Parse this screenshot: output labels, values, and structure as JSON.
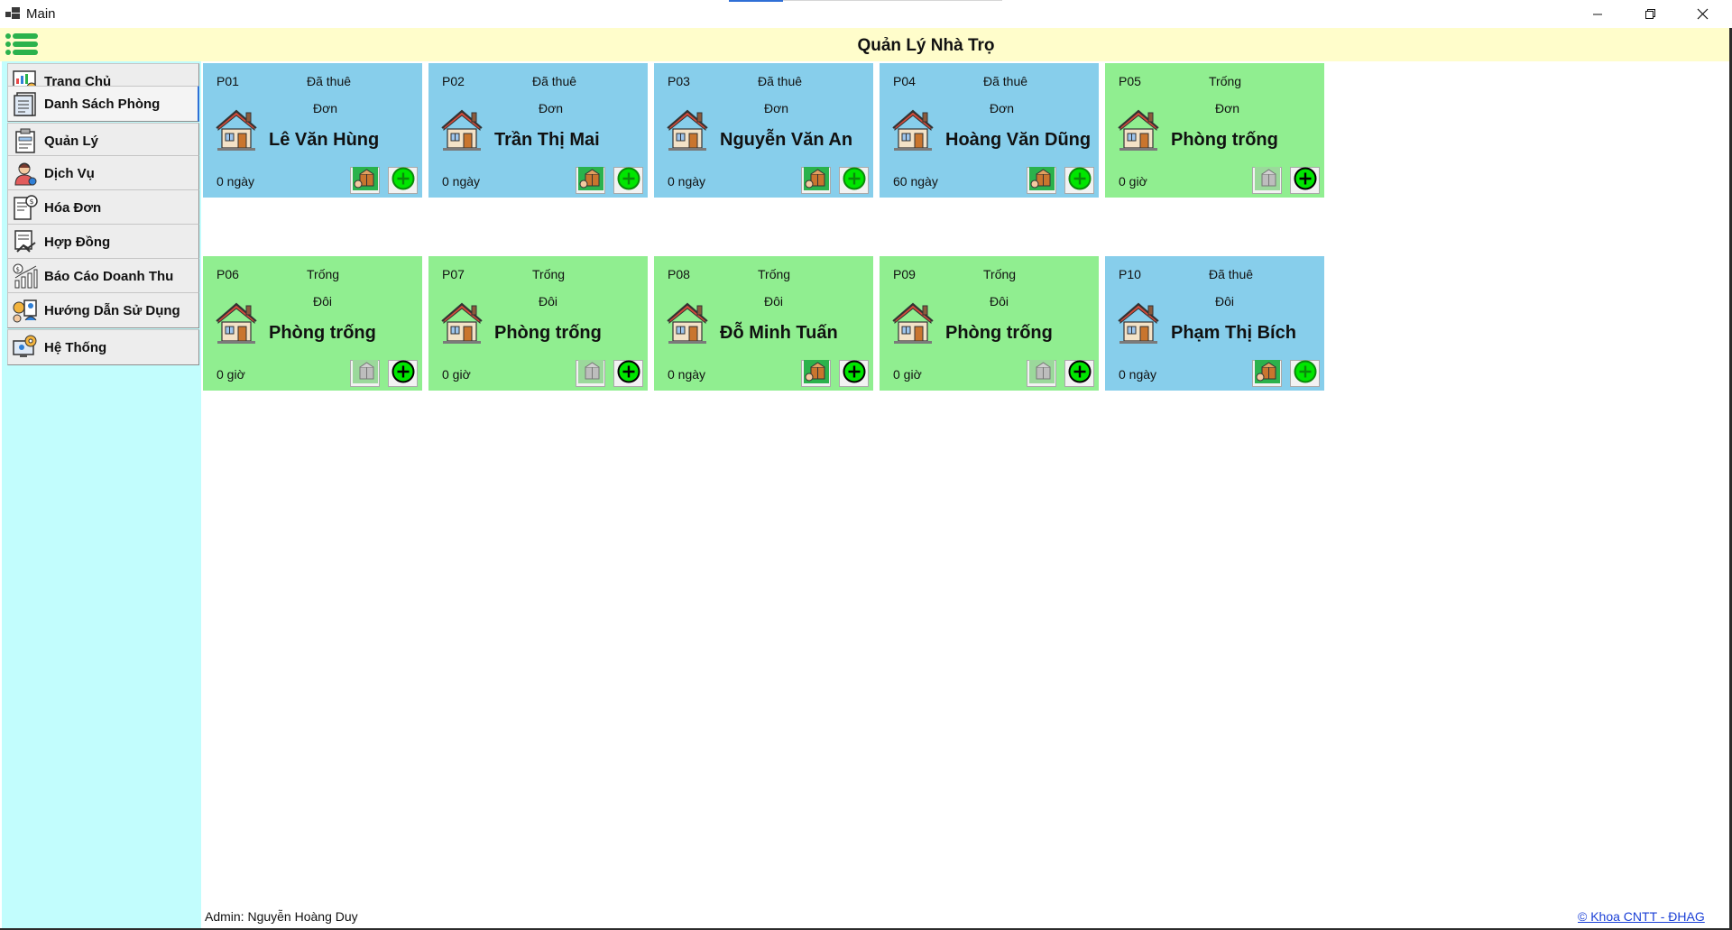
{
  "window": {
    "title": "Main",
    "controls": {
      "minimize": "minimize-icon",
      "restore": "restore-icon",
      "close": "close-icon"
    }
  },
  "header": {
    "title": "Quản Lý Nhà Trọ",
    "menu_icon": "hamburger-menu-icon",
    "background": "#fffdcb"
  },
  "sidebar": {
    "background": "#c2fdfd",
    "items": [
      {
        "label": "Trang Chủ",
        "icon": "dashboard-icon"
      },
      {
        "label": "Danh Sách Phòng",
        "icon": "room-list-icon",
        "active": true
      },
      {
        "label": "Quản Lý",
        "icon": "clipboard-icon"
      },
      {
        "label": "Dịch Vụ",
        "icon": "service-staff-icon"
      },
      {
        "label": "Hóa Đơn",
        "icon": "invoice-icon"
      },
      {
        "label": "Hợp Đồng",
        "icon": "contract-handshake-icon"
      },
      {
        "label": "Báo Cáo Doanh Thu",
        "icon": "revenue-chart-icon"
      },
      {
        "label": "Hướng Dẫn Sử Dụng",
        "icon": "user-guide-icon"
      },
      {
        "label": "Hệ Thống",
        "icon": "system-settings-icon"
      }
    ]
  },
  "colors": {
    "occupied": "#87ceeb",
    "vacant": "#90ee90",
    "add_button": "#00e600",
    "accent": "#2f6fd6"
  },
  "rooms": [
    {
      "code": "P01",
      "status": "Đã thuê",
      "type": "Đơn",
      "tenant": "Lê Văn Hùng",
      "duration": "0 ngày",
      "occupied": true
    },
    {
      "code": "P02",
      "status": "Đã thuê",
      "type": "Đơn",
      "tenant": "Trần Thị Mai",
      "duration": "0 ngày",
      "occupied": true
    },
    {
      "code": "P03",
      "status": "Đã thuê",
      "type": "Đơn",
      "tenant": "Nguyễn Văn An",
      "duration": "0 ngày",
      "occupied": true
    },
    {
      "code": "P04",
      "status": "Đã thuê",
      "type": "Đơn",
      "tenant": "Hoàng Văn Dũng",
      "duration": "60 ngày",
      "occupied": true
    },
    {
      "code": "P05",
      "status": "Trống",
      "type": "Đơn",
      "tenant": "Phòng trống",
      "duration": "0 giờ",
      "occupied": false
    },
    {
      "code": "P06",
      "status": "Trống",
      "type": "Đôi",
      "tenant": "Phòng trống",
      "duration": "0 giờ",
      "occupied": false
    },
    {
      "code": "P07",
      "status": "Trống",
      "type": "Đôi",
      "tenant": "Phòng trống",
      "duration": "0 giờ",
      "occupied": false
    },
    {
      "code": "P08",
      "status": "Trống",
      "type": "Đôi",
      "tenant": "Đỗ Minh Tuấn",
      "duration": "0 ngày",
      "occupied": false
    },
    {
      "code": "P09",
      "status": "Trống",
      "type": "Đôi",
      "tenant": "Phòng trống",
      "duration": "0 giờ",
      "occupied": false
    },
    {
      "code": "P10",
      "status": "Đã thuê",
      "type": "Đôi",
      "tenant": "Phạm Thị Bích",
      "duration": "0 ngày",
      "occupied": true
    }
  ],
  "footer": {
    "admin": "Admin: Nguyễn Hoàng Duy",
    "credit": "© Khoa CNTT - ĐHAG"
  }
}
